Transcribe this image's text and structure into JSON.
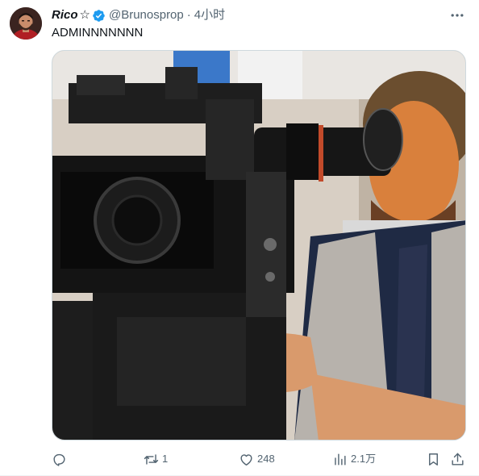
{
  "tweet": {
    "display_name": "Rico",
    "name_symbol": "☆",
    "handle": "@Brunosprop",
    "separator": "·",
    "time": "4小时",
    "text": "ADMINNNNNNN"
  },
  "actions": {
    "reply_count": "",
    "retweet_count": "1",
    "like_count": "248",
    "views_count": "2.1万"
  },
  "colors": {
    "text_primary": "#0f1419",
    "text_secondary": "#536471",
    "verified_blue": "#1d9bf0",
    "border": "#cfd9de"
  },
  "icons": {
    "verified": "verified-badge-icon",
    "more": "more-dots-icon",
    "reply": "reply-icon",
    "retweet": "retweet-icon",
    "like": "heart-icon",
    "views": "views-chart-icon",
    "bookmark": "bookmark-icon",
    "share": "share-icon"
  }
}
